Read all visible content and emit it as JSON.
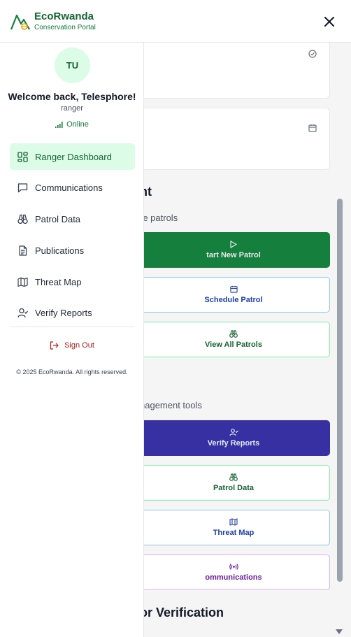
{
  "header": {
    "brand_name": "EcoRwanda",
    "brand_sub": "Conservation Portal"
  },
  "user": {
    "initials": "TU",
    "welcome": "Welcome back, Telesphore!",
    "role": "ranger",
    "status": "Online"
  },
  "nav": {
    "items": [
      {
        "label": "Ranger Dashboard",
        "icon": "dashboard-icon",
        "active": true
      },
      {
        "label": "Communications",
        "icon": "message-icon",
        "active": false
      },
      {
        "label": "Patrol Data",
        "icon": "binoculars-icon",
        "active": false
      },
      {
        "label": "Publications",
        "icon": "document-icon",
        "active": false
      },
      {
        "label": "Threat Map",
        "icon": "map-icon",
        "active": false
      },
      {
        "label": "Verify Reports",
        "icon": "user-check-icon",
        "active": false
      }
    ],
    "sign_out": "Sign Out",
    "copyright": "© 2025 EcoRwanda. All rights reserved."
  },
  "background": {
    "section1_title": "nt",
    "section1_sub": "re patrols",
    "start_patrol": "tart New Patrol",
    "schedule_patrol": "Schedule Patrol",
    "view_patrols": "View All Patrols",
    "section2_sub": "nagement tools",
    "verify_reports": "Verify Reports",
    "patrol_data": "Patrol Data",
    "threat_map": "Threat Map",
    "communications": "ommunications",
    "section3_title": "or Verification"
  },
  "colors": {
    "brand_green": "#166534",
    "active_bg": "#dcfce7",
    "danger": "#b91c1c",
    "indigo": "#3730a3",
    "solid_green": "#15803d"
  }
}
